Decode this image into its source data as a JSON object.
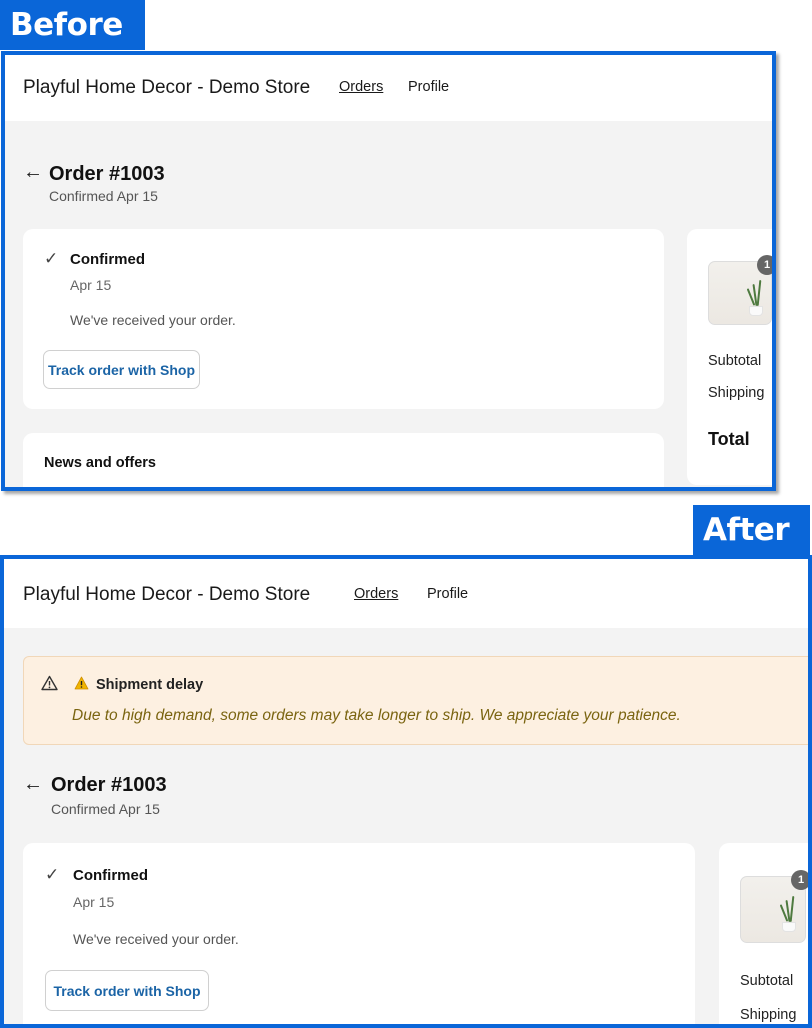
{
  "labels": {
    "before": "Before",
    "after": "After"
  },
  "store": {
    "name": "Playful Home Decor - Demo Store"
  },
  "nav": {
    "orders": "Orders",
    "profile": "Profile"
  },
  "banner": {
    "icon": "warning-triangle-outline-icon",
    "emoji": "⚠",
    "title": "Shipment delay",
    "message": "Due to high demand, some orders may take longer to ship. We appreciate your patience."
  },
  "order": {
    "back_icon": "←",
    "title": "Order #1003",
    "subtitle": "Confirmed Apr 15"
  },
  "status": {
    "check_icon": "✓",
    "title": "Confirmed",
    "date": "Apr 15",
    "message": "We've received your order.",
    "track_button": "Track order with Shop"
  },
  "news": {
    "title": "News and offers"
  },
  "summary": {
    "item_count": "1",
    "subtotal_label": "Subtotal",
    "shipping_label": "Shipping",
    "total_label": "Total"
  },
  "colors": {
    "accent": "#0a66d8",
    "link": "#1b64a6",
    "banner_bg": "#fdf0e1",
    "banner_text": "#7a6410",
    "page_bg": "#f3f3f3"
  }
}
